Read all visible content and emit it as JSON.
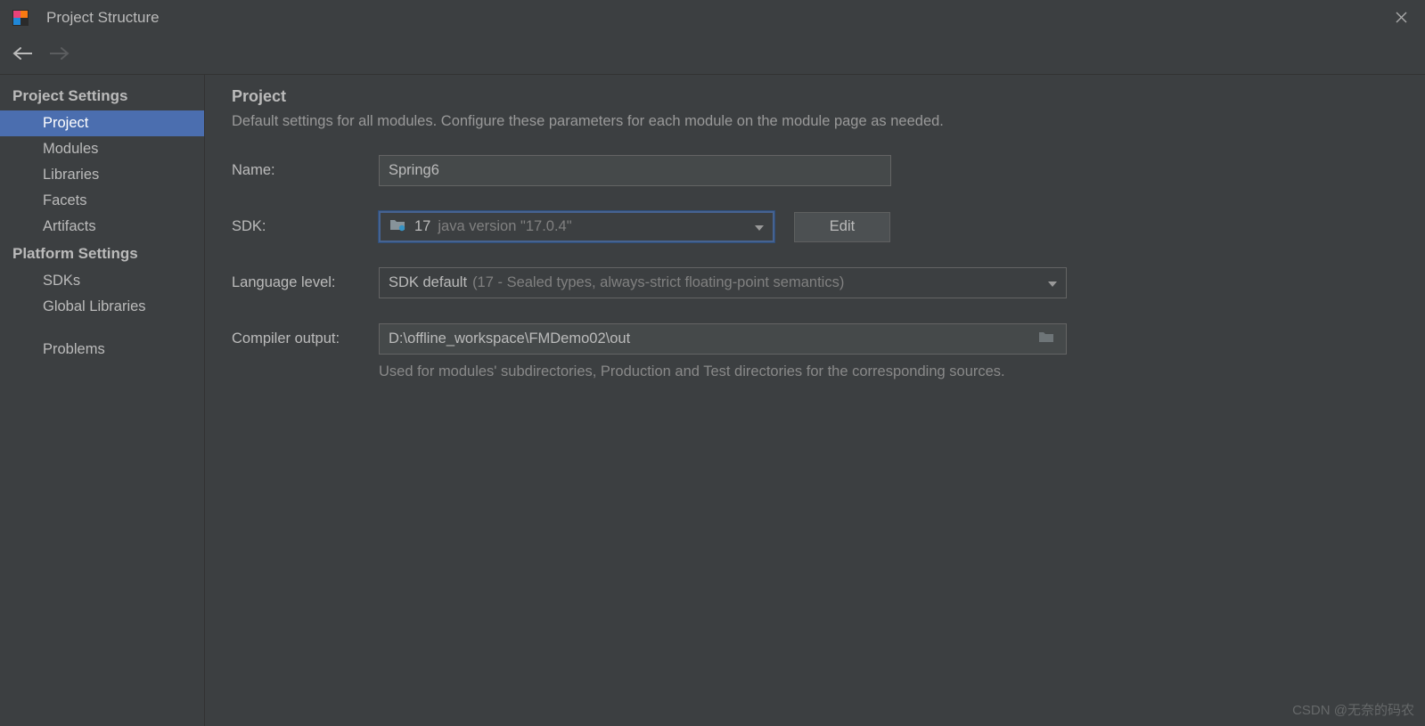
{
  "window": {
    "title": "Project Structure"
  },
  "sidebar": {
    "project_settings_header": "Project Settings",
    "platform_settings_header": "Platform Settings",
    "items_project": [
      "Project",
      "Modules",
      "Libraries",
      "Facets",
      "Artifacts"
    ],
    "items_platform": [
      "SDKs",
      "Global Libraries"
    ],
    "problems": "Problems"
  },
  "main": {
    "heading": "Project",
    "description": "Default settings for all modules. Configure these parameters for each module on the module page as needed.",
    "name_label": "Name:",
    "name_value": "Spring6",
    "sdk_label": "SDK:",
    "sdk_version": "17",
    "sdk_detail": "java version \"17.0.4\"",
    "edit_label": "Edit",
    "lang_label": "Language level:",
    "lang_main": "SDK default",
    "lang_detail": "(17 - Sealed types, always-strict floating-point semantics)",
    "output_label": "Compiler output:",
    "output_value": "D:\\offline_workspace\\FMDemo02\\out",
    "output_hint": "Used for modules' subdirectories, Production and Test directories for the corresponding sources."
  },
  "watermark": "CSDN @无奈的码农"
}
